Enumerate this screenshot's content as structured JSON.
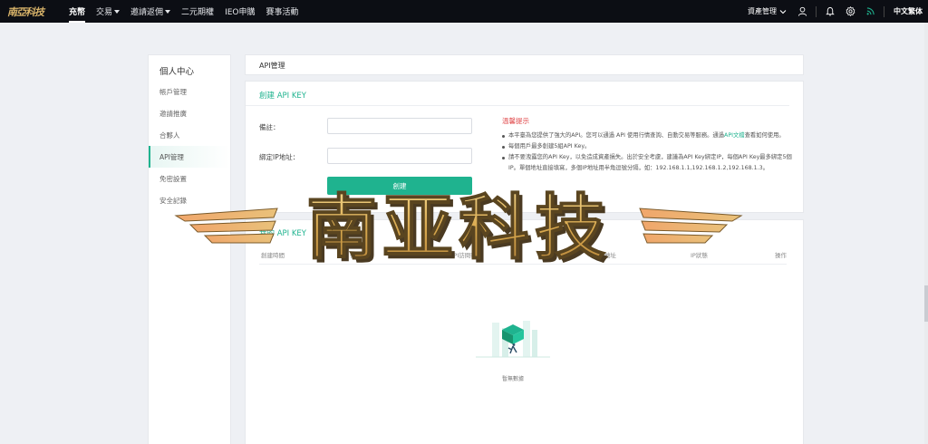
{
  "header": {
    "logo_text": "南亞科技",
    "nav": [
      {
        "label": "充幣",
        "active": true,
        "dropdown": false
      },
      {
        "label": "交易",
        "active": false,
        "dropdown": true
      },
      {
        "label": "邀請返佣",
        "active": false,
        "dropdown": true
      },
      {
        "label": "二元期權",
        "active": false,
        "dropdown": false
      },
      {
        "label": "IEO申購",
        "active": false,
        "dropdown": false
      },
      {
        "label": "賽事活動",
        "active": false,
        "dropdown": false
      }
    ],
    "asset_menu_label": "資產管理",
    "language_label": "中文繁体",
    "icons": [
      "user-icon",
      "bell-icon",
      "settings-icon",
      "rss-icon"
    ]
  },
  "sidebar": {
    "title": "個人中心",
    "items": [
      {
        "label": "帳戶管理",
        "active": false
      },
      {
        "label": "邀請推廣",
        "active": false
      },
      {
        "label": "合夥人",
        "active": false
      },
      {
        "label": "API管理",
        "active": true
      },
      {
        "label": "免密設置",
        "active": false
      },
      {
        "label": "安全記錄",
        "active": false
      }
    ]
  },
  "breadcrumb_panel": {
    "title": "API管理"
  },
  "create_panel": {
    "title": "創建 API KEY",
    "remark_label": "備註：",
    "remark_value": "",
    "ip_label": "綁定IP地址：",
    "ip_value": "",
    "create_button": "創建",
    "tips_title": "溫馨提示",
    "tips": [
      {
        "pre": "本平臺為您提供了強大的API。您可以通過 API 使用行情查詢、自動交易等服務。通過",
        "link": "API文檔",
        "post": "查看如何使用。"
      },
      {
        "pre": "每個用戶最多創建5組API Key。",
        "link": "",
        "post": ""
      },
      {
        "pre": "請不要洩露您的API Key，以免造成資產損失。出於安全考慮，建議為API Key綁定IP，每個API Key最多綁定5個IP。單個地址直接填寫，多個IP地址用半角逗號分隔，如：192.168.1.1,192.168.1.2,192.168.1.3。",
        "link": "",
        "post": ""
      }
    ]
  },
  "list_panel": {
    "title": "我的 API KEY",
    "columns": [
      "創建時間",
      "備註",
      "API訪問密鑰",
      "IP地址",
      "IP狀態",
      "操作"
    ],
    "empty_text": "暫無數據"
  },
  "watermark": {
    "text": "南亚科技"
  },
  "colors": {
    "accent": "#1fb38f",
    "header_bg": "#0c0e14",
    "warning": "#e0494b",
    "gold": "#d9b46a"
  }
}
